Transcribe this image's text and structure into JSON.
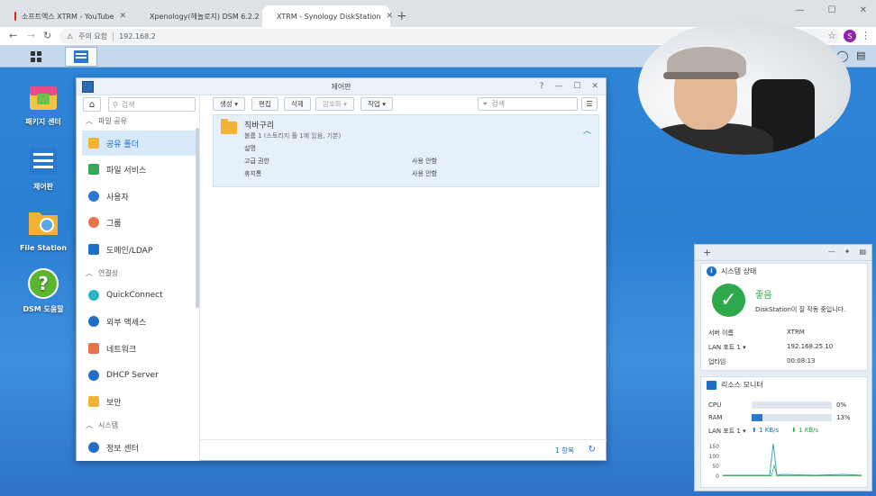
{
  "browser": {
    "tabs": [
      {
        "title": "소프트엑스 XTRM - YouTube",
        "favicon_color": "#e62117"
      },
      {
        "title": "Xpenology(헤놀로지) DSM 6.2.2",
        "favicon_color": "#3aa757"
      },
      {
        "title": "XTRM - Synology DiskStation",
        "favicon_color": "#1f6fc5"
      }
    ],
    "security_label": "주의 요함",
    "url": "192.168.2",
    "profile_initial": "S"
  },
  "desktop": {
    "icons": [
      {
        "label": "패키지 센터"
      },
      {
        "label": "제어판"
      },
      {
        "label": "File Station"
      },
      {
        "label": "DSM 도움말"
      }
    ]
  },
  "control_panel": {
    "title": "제어판",
    "search_placeholder": "검색",
    "sections": [
      {
        "label": "파일 공유"
      },
      {
        "label": "연결성"
      },
      {
        "label": "시스템"
      }
    ],
    "items": [
      {
        "label": "공유 폴더",
        "color": "#f2b234"
      },
      {
        "label": "파일 서비스",
        "color": "#3aa757"
      },
      {
        "label": "사용자",
        "color": "#2b78d0"
      },
      {
        "label": "그룹",
        "color": "#e8734a"
      },
      {
        "label": "도메인/LDAP",
        "color": "#1f6fc5"
      },
      {
        "label": "QuickConnect",
        "color": "#29b6c8"
      },
      {
        "label": "외부 액세스",
        "color": "#1f6fc5"
      },
      {
        "label": "네트워크",
        "color": "#e8734a"
      },
      {
        "label": "DHCP Server",
        "color": "#1f6fc5"
      },
      {
        "label": "보안",
        "color": "#f2b234"
      },
      {
        "label": "정보 센터",
        "color": "#1f6fc5"
      }
    ],
    "toolbar": {
      "create": "생성",
      "edit": "편집",
      "delete": "삭제",
      "encrypt": "암호화",
      "action": "작업",
      "filter_placeholder": "검색"
    },
    "folder": {
      "name": "직바구리",
      "subtitle": "볼륨 1 (스토리지 풀 1에 있음, 기본)",
      "desc_label": "설명",
      "adv_label": "고급 권한",
      "adv_value": "사용 안함",
      "recycle_label": "휴지통",
      "recycle_value": "사용 안함"
    },
    "count": "1 항목"
  },
  "widgets": {
    "system": {
      "title": "시스템 상태",
      "status": "좋음",
      "desc": "DiskStation이 잘 작동 중입니다.",
      "server_label": "서버 이름",
      "server_value": "XTRM",
      "lan_label": "LAN 포트 1",
      "lan_value": "192.168.25.10",
      "uptime_label": "업타임",
      "uptime_value": "00:08:13"
    },
    "resource": {
      "title": "리소스 모니터",
      "cpu_label": "CPU",
      "cpu_pct": "0%",
      "cpu_value": 0,
      "ram_label": "RAM",
      "ram_pct": "13%",
      "ram_value": 13,
      "lan_label": "LAN 포트 1",
      "lan_up": "1 KB/s",
      "lan_down": "1 KB/s",
      "chart_ticks": [
        "150",
        "100",
        "50",
        "0"
      ]
    }
  }
}
